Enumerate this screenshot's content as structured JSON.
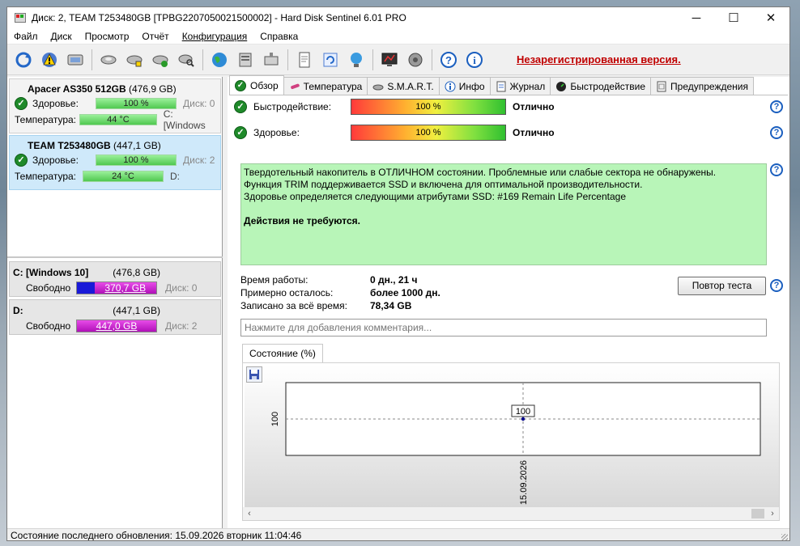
{
  "window": {
    "title": "Диск: 2, TEAM T253480GB [TPBG2207050021500002]  -  Hard Disk Sentinel 6.01 PRO",
    "minimize": "─",
    "maximize": "☐",
    "close": "✕"
  },
  "menu": [
    "Файл",
    "Диск",
    "Просмотр",
    "Отчёт",
    "Конфигурация",
    "Справка"
  ],
  "toolbar": {
    "unregistered": "Незарегистрированная версия."
  },
  "disks": [
    {
      "name": "Apacer AS350 512GB",
      "size": "(476,9 GB)",
      "health_label": "Здоровье:",
      "health_value": "100 %",
      "health_volume": "Диск: 0",
      "temp_label": "Температура:",
      "temp_value": "44 °C",
      "temp_volume": "C: [Windows"
    },
    {
      "name": "TEAM T253480GB",
      "size": "(447,1 GB)",
      "health_label": "Здоровье:",
      "health_value": "100 %",
      "health_volume": "Диск: 2",
      "temp_label": "Температура:",
      "temp_value": "24 °C",
      "temp_volume": "D:"
    }
  ],
  "partitions": [
    {
      "name": "C: [Windows 10]",
      "size": "(476,8 GB)",
      "free_label": "Свободно",
      "free_value": "370,7 GB",
      "disk": "Диск: 0",
      "used_fraction": 0.22
    },
    {
      "name": "D:",
      "size": "(447,1 GB)",
      "free_label": "Свободно",
      "free_value": "447,0 GB",
      "disk": "Диск: 2",
      "used_fraction": 0.0
    }
  ],
  "tabs": [
    "Обзор",
    "Температура",
    "S.M.A.R.T.",
    "Инфо",
    "Журнал",
    "Быстродействие",
    "Предупреждения"
  ],
  "overview": {
    "performance_label": "Быстродействие:",
    "performance_value": "100 %",
    "performance_status": "Отлично",
    "health_label": "Здоровье:",
    "health_value": "100 %",
    "health_status": "Отлично",
    "message_lines": [
      "Твердотельный накопитель в ОТЛИЧНОМ состоянии. Проблемные или слабые сектора не обнаружены.",
      "Функция TRIM поддерживается SSD и включена для оптимальной производительности.",
      "Здоровье определяется следующими атрибутами SSD: #169 Remain Life Percentage"
    ],
    "message_action": "Действия не требуются.",
    "uptime_label": "Время работы:",
    "uptime_value": "0 дн., 21 ч",
    "remaining_label": "Примерно осталось:",
    "remaining_value": "более 1000 дн.",
    "written_label": "Записано за всё время:",
    "written_value": "78,34 GB",
    "retest_button": "Повтор теста",
    "comment_placeholder": "Нажмите для добавления комментария...",
    "help": "?"
  },
  "chart_tab": "Состояние (%)",
  "chart_data": {
    "type": "line",
    "x": [
      "15.09.2026"
    ],
    "series": [
      {
        "values": [
          100
        ]
      }
    ],
    "ytick": "100",
    "data_label": "100",
    "grid": true
  },
  "statusbar": "Состояние последнего обновления: 15.09.2026 вторник 11:04:46"
}
